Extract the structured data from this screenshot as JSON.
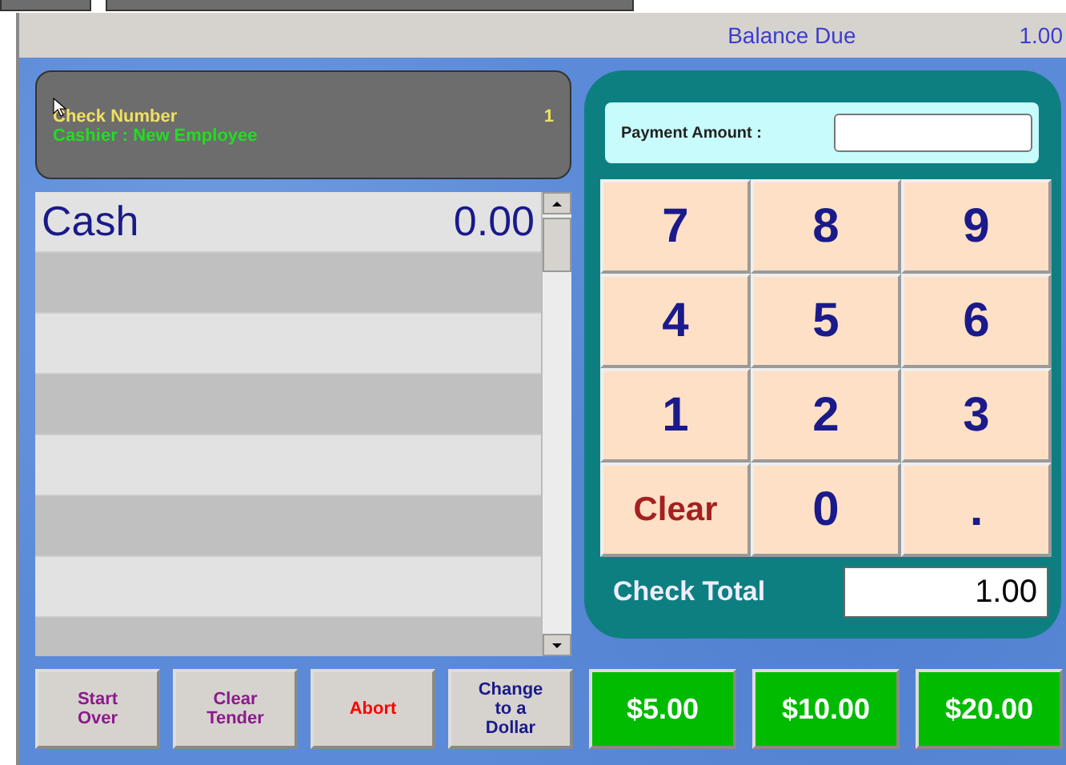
{
  "header": {
    "label": "Balance Due",
    "value": "1.00"
  },
  "info": {
    "check_label": "Check Number",
    "check_number": "1",
    "cashier": "Cashier : New Employee"
  },
  "tenders": [
    {
      "name": "Cash",
      "amount": "0.00"
    }
  ],
  "payment": {
    "label": "Payment Amount :"
  },
  "keypad": [
    {
      "label": "7",
      "kind": "digit"
    },
    {
      "label": "8",
      "kind": "digit"
    },
    {
      "label": "9",
      "kind": "digit"
    },
    {
      "label": "4",
      "kind": "digit"
    },
    {
      "label": "5",
      "kind": "digit"
    },
    {
      "label": "6",
      "kind": "digit"
    },
    {
      "label": "1",
      "kind": "digit"
    },
    {
      "label": "2",
      "kind": "digit"
    },
    {
      "label": "3",
      "kind": "digit"
    },
    {
      "label": "Clear",
      "kind": "clear"
    },
    {
      "label": "0",
      "kind": "digit"
    },
    {
      "label": ".",
      "kind": "decimal"
    }
  ],
  "check_total": {
    "label": "Check Total",
    "value": "1.00"
  },
  "buttons": [
    {
      "label": "Start Over",
      "kind": "action",
      "color": "#8b1a8b"
    },
    {
      "label": "Clear Tender",
      "kind": "action",
      "color": "#8b1a8b"
    },
    {
      "label": "Abort",
      "kind": "action",
      "color": "#ff0000"
    },
    {
      "label": "Change to a Dollar",
      "kind": "action",
      "color": "#1a1a8b"
    },
    {
      "label": "$5.00",
      "kind": "cash"
    },
    {
      "label": "$10.00",
      "kind": "cash"
    },
    {
      "label": "$20.00",
      "kind": "cash"
    }
  ]
}
